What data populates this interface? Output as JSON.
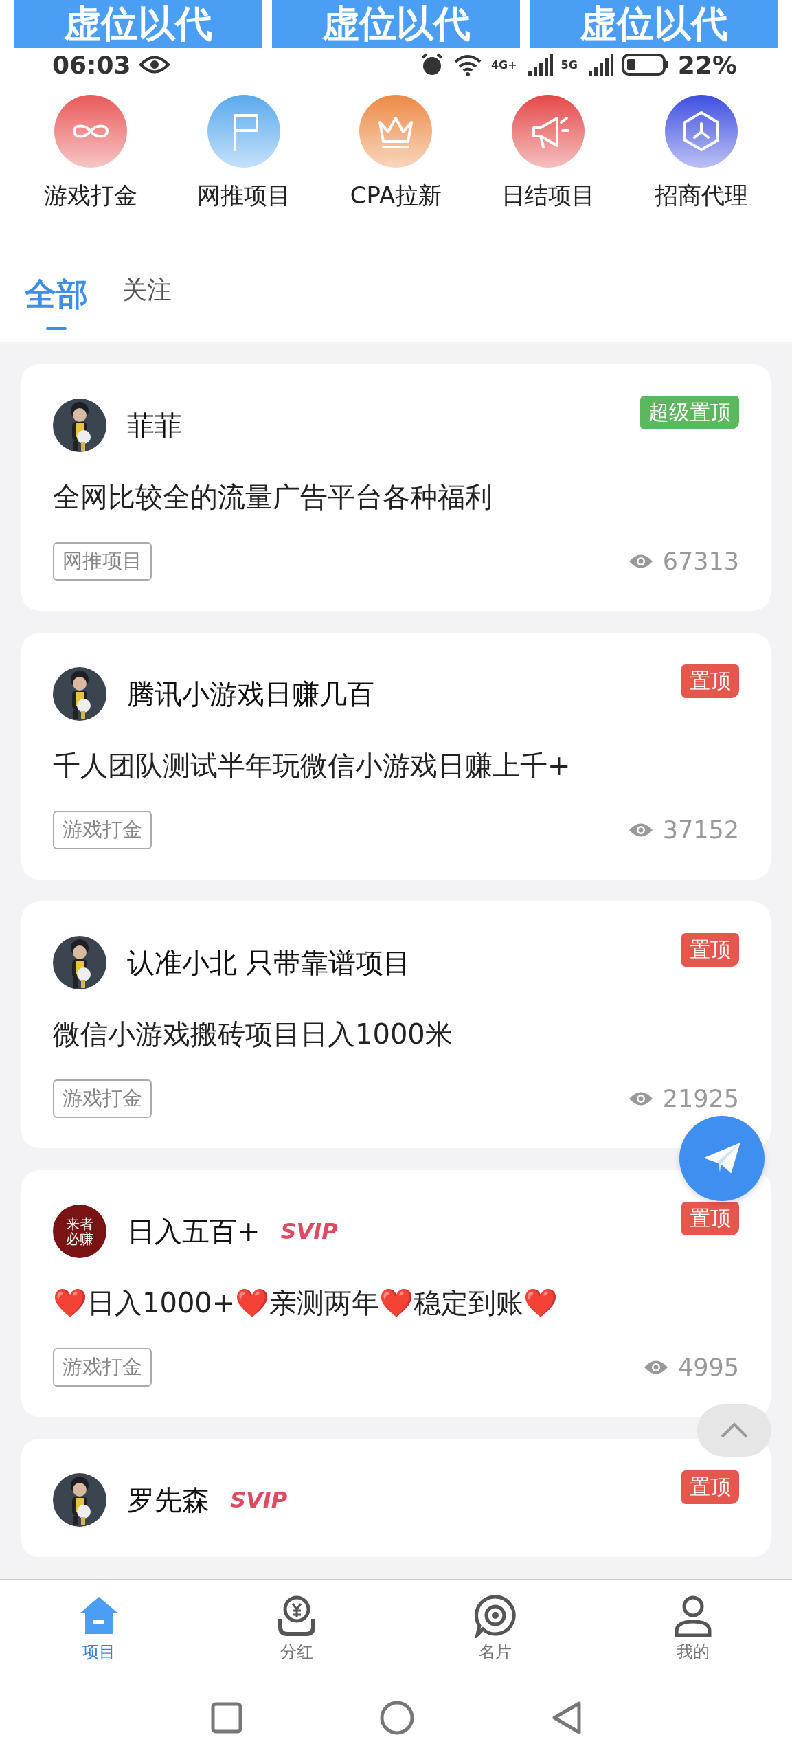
{
  "banner": [
    "虚位以代",
    "虚位以代",
    "虚位以代"
  ],
  "status_bar": {
    "time": "06:03",
    "network_4g": "4G+",
    "network_5g": "5G",
    "battery": "22%"
  },
  "categories": [
    {
      "label": "游戏打金",
      "kind": "infinity",
      "color": "#e85a5a"
    },
    {
      "label": "网推项目",
      "kind": "flag",
      "color": "#5aa9ee"
    },
    {
      "label": "CPA拉新",
      "kind": "crown",
      "color": "#ec8a45"
    },
    {
      "label": "日结项目",
      "kind": "megaphone",
      "color": "#e44848"
    },
    {
      "label": "招商代理",
      "kind": "hexagon",
      "color": "#3f4fe0"
    }
  ],
  "tabs": [
    {
      "label": "全部",
      "selected": true
    },
    {
      "label": "关注",
      "selected": false
    }
  ],
  "posts": [
    {
      "author": "菲菲",
      "pin": {
        "label": "超级置顶",
        "color": "#5cb85c"
      },
      "title": "全网比较全的流量广告平台各种福利",
      "tag": "网推项目",
      "views": "67313"
    },
    {
      "author": "腾讯小游戏日赚几百",
      "pin": {
        "label": "置顶",
        "color": "#e5574d"
      },
      "title": "千人团队测试半年玩微信小游戏日赚上千+",
      "tag": "游戏打金",
      "views": "37152"
    },
    {
      "author": "认准小北 只带靠谱项目",
      "pin": {
        "label": "置顶",
        "color": "#e5574d"
      },
      "title": "微信小游戏搬砖项目日入1000米",
      "tag": "游戏打金",
      "views": "21925"
    },
    {
      "author": "日入五百+",
      "svip": "SVIP",
      "avatar": {
        "kind": "text",
        "text": "来者必赚"
      },
      "pin": {
        "label": "置顶",
        "color": "#e5574d"
      },
      "title": "❤️日入1000+❤️亲测两年❤️稳定到账❤️",
      "tag": "游戏打金",
      "views": "4995"
    },
    {
      "author": "罗先森",
      "svip": "SVIP",
      "pin": {
        "label": "置顶",
        "color": "#e5574d"
      }
    }
  ],
  "bottom_nav": [
    {
      "label": "项目",
      "kind": "home",
      "selected": true
    },
    {
      "label": "分红",
      "kind": "money",
      "selected": false
    },
    {
      "label": "名片",
      "kind": "target",
      "selected": false
    },
    {
      "label": "我的",
      "kind": "person",
      "selected": false
    }
  ]
}
